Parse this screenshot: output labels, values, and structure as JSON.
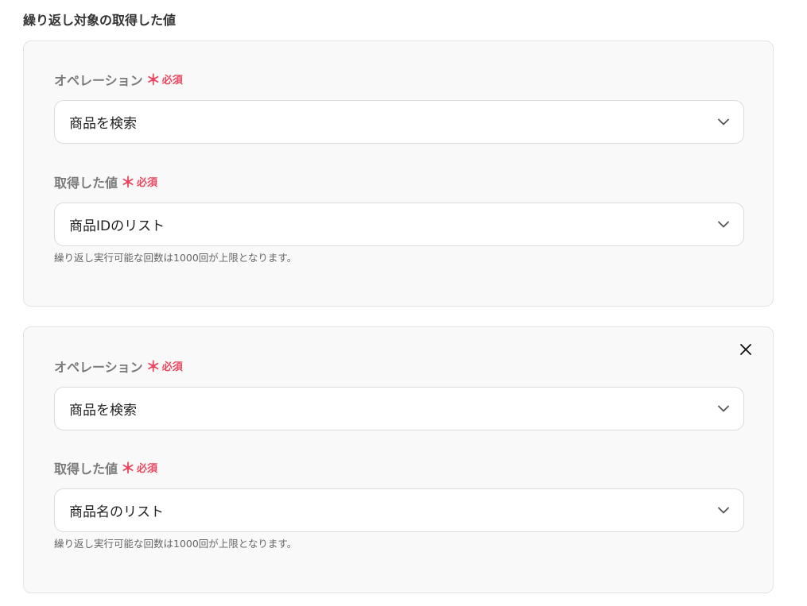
{
  "section_title": "繰り返し対象の取得した値",
  "required_mark": "＊",
  "required_text": "必須",
  "icons": {
    "chevron": "chevron-down-icon",
    "close": "close-icon"
  },
  "colors": {
    "required": "#e8475f",
    "panel_bg": "#f9f9f9"
  },
  "panels": [
    {
      "operation_label": "オペレーション",
      "operation_value": "商品を検索",
      "value_label": "取得した値",
      "value_value": "商品IDのリスト",
      "hint": "繰り返し実行可能な回数は1000回が上限となります。"
    },
    {
      "operation_label": "オペレーション",
      "operation_value": "商品を検索",
      "value_label": "取得した値",
      "value_value": "商品名のリスト",
      "hint": "繰り返し実行可能な回数は1000回が上限となります。"
    }
  ]
}
